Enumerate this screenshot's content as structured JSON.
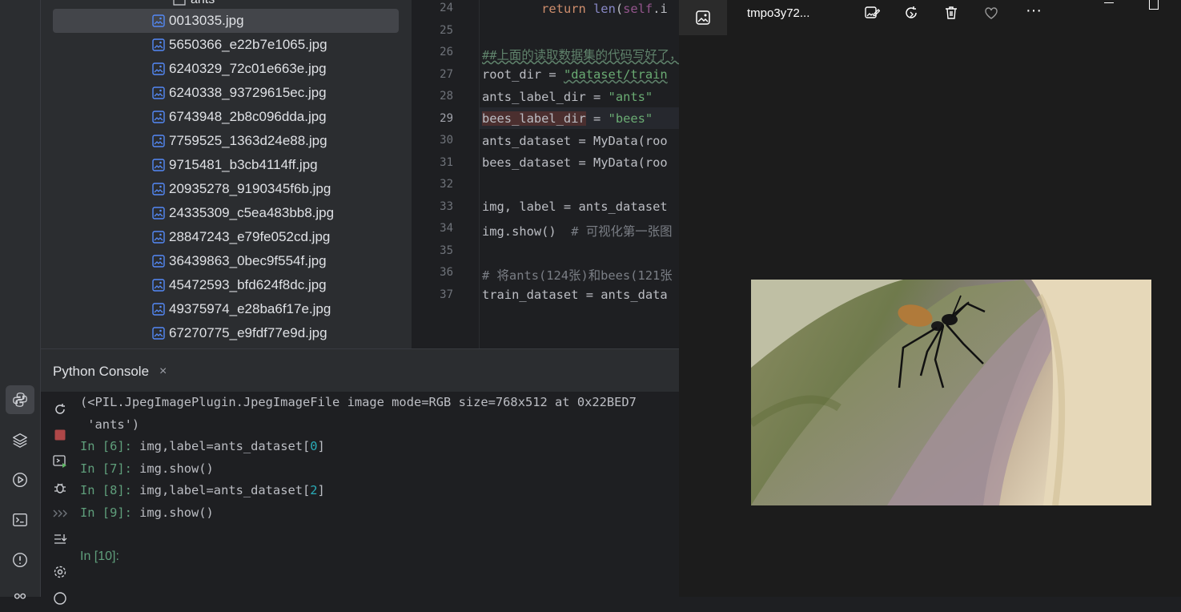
{
  "project": {
    "folder_label": "ants",
    "files": [
      "0013035.jpg",
      "5650366_e22b7e1065.jpg",
      "6240329_72c01e663e.jpg",
      "6240338_93729615ec.jpg",
      "6743948_2b8c096dda.jpg",
      "7759525_1363d24e88.jpg",
      "9715481_b3cb4114ff.jpg",
      "20935278_9190345f6b.jpg",
      "24335309_c5ea483bb8.jpg",
      "28847243_e79fe052cd.jpg",
      "36439863_0bec9f554f.jpg",
      "45472593_bfd624f8dc.jpg",
      "49375974_e28ba6f17e.jpg",
      "67270775_e9fdf77e9d.jpg"
    ],
    "selected_index": 0
  },
  "editor": {
    "current_line": "29",
    "line_numbers": [
      "24",
      "25",
      "26",
      "27",
      "28",
      "29",
      "30",
      "31",
      "32",
      "33",
      "34",
      "35",
      "36",
      "37"
    ],
    "lines": {
      "l24": {
        "kw": "return",
        "builtin": "len",
        "rest_a": "(",
        "self": "self",
        "rest_b": ".i"
      },
      "l26": "##上面的读取数据集的代码写好了，",
      "l27": {
        "name": "root_dir",
        "op": " = ",
        "str": "\"dataset/train"
      },
      "l28": {
        "name": "ants_label_dir",
        "op": " = ",
        "str": "\"ants\""
      },
      "l29": {
        "name": "bees_label_dir",
        "op": " = ",
        "str": "\"bees\""
      },
      "l30": "ants_dataset = MyData(roo",
      "l31": "bees_dataset = MyData(roo",
      "l33": "img, label = ants_dataset",
      "l34": {
        "code": "img.show()  ",
        "cmt": "# 可视化第一张图"
      },
      "l36": "# 将ants(124张)和bees(121张",
      "l37": "train_dataset = ants_data"
    }
  },
  "console": {
    "tab_label": "Python Console",
    "close_glyph": "×",
    "output_line1": "(<PIL.JpegImagePlugin.JpegImageFile image mode=RGB size=768x512 at 0x22BED7",
    "output_line2": " 'ants')",
    "history": [
      {
        "prompt": "In [6]: ",
        "code_a": "img,label=ants_dataset[",
        "num": "0",
        "code_b": "]"
      },
      {
        "prompt": "In [7]: ",
        "code_a": "img.show()",
        "num": "",
        "code_b": ""
      },
      {
        "prompt": "In [8]: ",
        "code_a": "img,label=ants_dataset[",
        "num": "2",
        "code_b": "]"
      },
      {
        "prompt": "In [9]: ",
        "code_a": "img.show()",
        "num": "",
        "code_b": ""
      }
    ],
    "input_prompt": "In [10]:"
  },
  "viewer": {
    "title": "tmpo3y72...",
    "more_glyph": "···"
  },
  "colors": {
    "ide_bg": "#1e1f22",
    "panel_bg": "#2b2d30",
    "selection": "#43454a",
    "keyword": "#cf8e6d",
    "string": "#6aab73",
    "prompt": "#5f9e7b",
    "number": "#2aacb8",
    "viewer_bg": "#1c1c1c"
  }
}
